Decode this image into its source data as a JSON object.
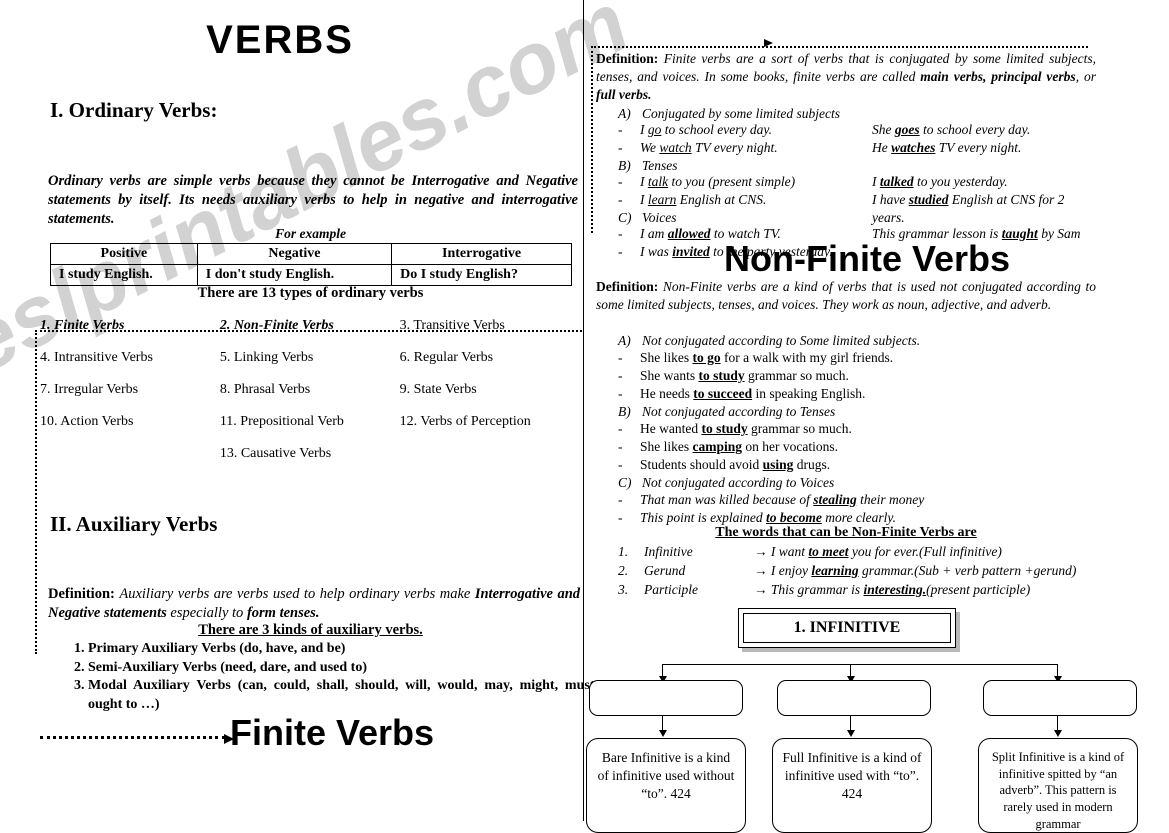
{
  "watermark": "eslprintables.com",
  "document": {
    "title": "VERBS"
  },
  "left": {
    "heading_ordinary": "I. Ordinary Verbs:",
    "ordinary_definition": "Ordinary verbs are simple verbs because they cannot be Interrogative and Negative statements by itself. Its needs auxiliary verbs to help in negative and interrogative statements.",
    "for_example": "For example",
    "table": {
      "headers": [
        "Positive",
        "Negative",
        "Interrogative"
      ],
      "row": [
        "I study English.",
        "I don't study English.",
        "Do I study English?"
      ]
    },
    "types_heading": "There are 13 types of ordinary verbs",
    "types": [
      "1. Finite Verbs",
      "2. Non-Finite Verbs",
      "3. Transitive Verbs",
      "4. Intransitive Verbs",
      "5. Linking Verbs",
      "6. Regular Verbs",
      "7. Irregular Verbs",
      "8. Phrasal Verbs",
      "9. State Verbs",
      "10. Action Verbs",
      "11. Prepositional Verb",
      "12. Verbs of Perception",
      "",
      "13. Causative Verbs",
      ""
    ],
    "heading_auxiliary": "II. Auxiliary Verbs",
    "aux_definition": {
      "label": "Definition:",
      "part1": "Auxiliary verbs are verbs used to help ordinary verbs make",
      "part2": "Interrogative and Negative statements",
      "part3": "especially to",
      "part4": "form tenses."
    },
    "aux_kinds_heading": "There are 3 kinds of auxiliary verbs.",
    "aux_kinds": [
      "Primary Auxiliary Verbs (do, have, and be)",
      "Semi-Auxiliary Verbs (need, dare, and used to)",
      "Modal Auxiliary Verbs (can, could, shall, should, will, would, may, might, must, ought to …)"
    ],
    "finite_callout": "Finite Verbs"
  },
  "right": {
    "finite": {
      "def_label": "Definition:",
      "def_part1": "Finite verbs are a sort of verbs that is conjugated by some limited subjects, tenses, and voices. In some books, finite verbs are called ",
      "def_bold1": "main verbs, principal verbs",
      "def_mid": ", or ",
      "def_bold2": "full verbs.",
      "sections": [
        {
          "letter": "A)",
          "label": "Conjugated by some limited subjects",
          "examples": [
            {
              "left_pre": "I ",
              "left_u": "go",
              "left_post": " to school every day.",
              "right_pre": "She ",
              "right_u": "goes",
              "right_post": " to school every day."
            },
            {
              "left_pre": "We ",
              "left_u": "watch",
              "left_post": " TV every night.",
              "right_pre": "He ",
              "right_u": "watches",
              "right_post": " TV every night."
            }
          ]
        },
        {
          "letter": "B)",
          "label": "Tenses",
          "examples": [
            {
              "left_pre": "I ",
              "left_u": "talk",
              "left_post": " to you (present simple)",
              "right_pre": "I ",
              "right_u": "talked",
              "right_post": " to you yesterday."
            },
            {
              "left_pre": "I ",
              "left_u": "learn",
              "left_post": " English at CNS.",
              "right_pre": "I have ",
              "right_u": "studied",
              "right_post": " English at CNS for 2 years."
            }
          ]
        },
        {
          "letter": "C)",
          "label": "Voices",
          "examples": [
            {
              "left_pre": "I am ",
              "left_u": "allowed",
              "left_post": " to watch TV.",
              "right_pre": "This grammar lesson is ",
              "right_u": "taught",
              "right_post": " by Sam"
            },
            {
              "left_pre": "I was ",
              "left_u": "invited",
              "left_post": " to the party yesterday.",
              "right_pre": "",
              "right_u": "",
              "right_post": ""
            }
          ]
        }
      ]
    },
    "nonfinite_title": "Non-Finite Verbs",
    "nonfinite": {
      "def_label": "Definition:",
      "def_text": "Non-Finite verbs are a kind of verbs that is used not conjugated according to some limited subjects, tenses, and voices. They work as noun, adjective, and adverb.",
      "sections": [
        {
          "letter": "A)",
          "label": "Not conjugated according to Some limited subjects.",
          "examples": [
            {
              "pre": "She likes ",
              "u": "to go",
              "post": " for a walk with my girl friends."
            },
            {
              "pre": "She wants ",
              "u": "to study",
              "post": " grammar so much."
            },
            {
              "pre": "He needs ",
              "u": "to succeed",
              "post": " in speaking English."
            }
          ]
        },
        {
          "letter": "B)",
          "label": "Not conjugated according to Tenses",
          "examples": [
            {
              "pre": "He wanted ",
              "u": "to study",
              "post": " grammar so much."
            },
            {
              "pre": "She likes ",
              "u": "camping",
              "post": " on her vocations."
            },
            {
              "pre": "Students should avoid ",
              "u": "using",
              "post": " drugs."
            }
          ]
        },
        {
          "letter": "C)",
          "label": "Not conjugated according to Voices",
          "examples": [
            {
              "pre": "That man was killed because of ",
              "u": "stealing",
              "post": " their money"
            },
            {
              "pre": "This point is explained ",
              "u": "to become",
              "post": " more clearly."
            }
          ]
        }
      ],
      "words_heading": "The words that can be Non-Finite Verbs are",
      "words": [
        {
          "num": "1.",
          "term": "Infinitive",
          "arrow": "→",
          "pre": "I want ",
          "u": "to meet",
          "post": " you for ever.",
          "note": "(Full infinitive)"
        },
        {
          "num": "2.",
          "term": "Gerund",
          "arrow": "→",
          "pre": "I enjoy ",
          "u": "learning",
          "post": " grammar.",
          "note": "(Sub + verb pattern +gerund)"
        },
        {
          "num": "3.",
          "term": "Participle",
          "arrow": "→",
          "pre": "This grammar is ",
          "u": "interesting.",
          "post": "",
          "note": "(present participle)"
        }
      ]
    },
    "infinitive_diagram": {
      "title": "1. INFINITIVE",
      "mid_boxes": [
        "",
        "",
        ""
      ],
      "leaves": [
        "Bare Infinitive is a kind of infinitive used without “to”. 424",
        "Full Infinitive is a kind of infinitive used with “to”. 424",
        "Split Infinitive is a kind of infinitive spitted by “an adverb”. This pattern is rarely used in modern grammar"
      ]
    }
  }
}
